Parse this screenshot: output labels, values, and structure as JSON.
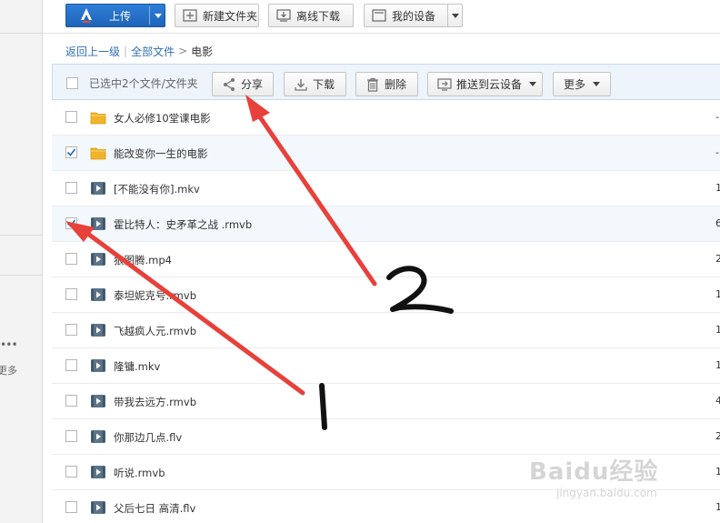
{
  "sidebar": {
    "more_dots": "•••",
    "more_label": "更多"
  },
  "toolbar": {
    "upload_label": "上传",
    "new_folder_label": "新建文件夹",
    "offline_download_label": "离线下载",
    "my_devices_label": "我的设备"
  },
  "breadcrumb": {
    "back_label": "返回上一级",
    "all_files_label": "全部文件",
    "separator": ">",
    "current": "电影"
  },
  "actionbar": {
    "selection_text": "已选中2个文件/文件夹",
    "share_label": "分享",
    "download_label": "下载",
    "delete_label": "删除",
    "push_label": "推送到云设备",
    "more_label": "更多"
  },
  "files": [
    {
      "name": "女人必修10堂课电影",
      "type": "folder",
      "checked": false,
      "meta": "-"
    },
    {
      "name": "能改变你一生的电影",
      "type": "folder",
      "checked": true,
      "meta": "-"
    },
    {
      "name": "[不能没有你].mkv",
      "type": "video",
      "checked": false,
      "meta": "1"
    },
    {
      "name": "霍比特人：史矛革之战 .rmvb",
      "type": "video",
      "checked": true,
      "meta": "6"
    },
    {
      "name": "狼图腾.mp4",
      "type": "video",
      "checked": false,
      "meta": "2"
    },
    {
      "name": "泰坦妮克号.rmvb",
      "type": "video",
      "checked": false,
      "meta": "1"
    },
    {
      "name": "飞越疯人元.rmvb",
      "type": "video",
      "checked": false,
      "meta": "1"
    },
    {
      "name": "隆镛.mkv",
      "type": "video",
      "checked": false,
      "meta": "1"
    },
    {
      "name": "带我去远方.rmvb",
      "type": "video",
      "checked": false,
      "meta": "4"
    },
    {
      "name": "你那边几点.flv",
      "type": "video",
      "checked": false,
      "meta": "2"
    },
    {
      "name": "听说.rmvb",
      "type": "video",
      "checked": false,
      "meta": "1"
    },
    {
      "name": "父后七日 高清.flv",
      "type": "video",
      "checked": false,
      "meta": "1"
    }
  ],
  "annotations": {
    "label_1": "1",
    "label_2": "2",
    "arrow_color": "#e8403a"
  },
  "watermark": {
    "brand": "Baidu经验",
    "url": "jingyan.baidu.com"
  },
  "colors": {
    "primary_button": "#1f64b8",
    "link": "#2f6fb5",
    "folder": "#f0b429",
    "check": "#2f6fb5"
  }
}
